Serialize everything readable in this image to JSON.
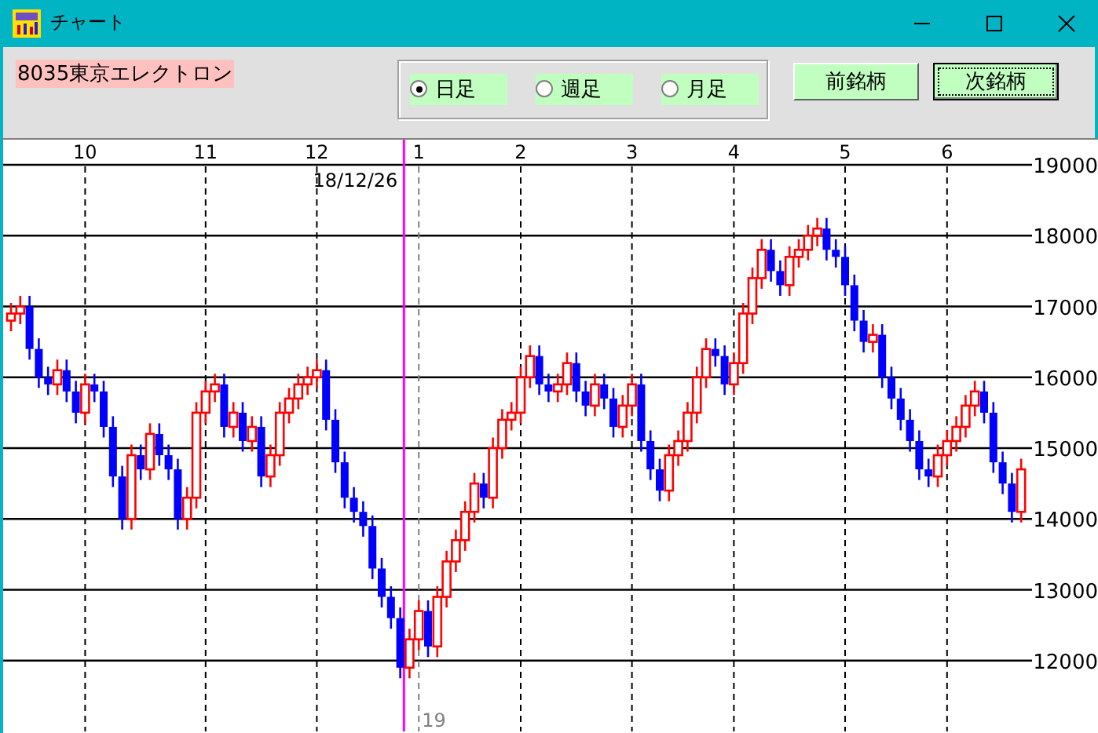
{
  "window": {
    "title": "チャート"
  },
  "stock_label": "8035東京エレクトロン",
  "period_options": [
    {
      "label": "日足",
      "selected": true
    },
    {
      "label": "週足",
      "selected": false
    },
    {
      "label": "月足",
      "selected": false
    }
  ],
  "buttons": [
    {
      "label": "前銘柄",
      "focused": false
    },
    {
      "label": "次銘柄",
      "focused": true
    }
  ],
  "chart": {
    "cursor_date": "18/12/26",
    "year_label": "19",
    "chart_data": {
      "type": "candlestick",
      "grid": true,
      "ylim": [
        11000,
        19000
      ],
      "yticks": [
        12000,
        13000,
        14000,
        15000,
        16000,
        17000,
        18000,
        19000
      ],
      "categories": [
        null,
        null,
        null,
        null,
        null,
        null,
        null,
        null,
        "10",
        null,
        null,
        null,
        null,
        null,
        null,
        null,
        null,
        null,
        null,
        null,
        null,
        "11",
        null,
        null,
        null,
        null,
        null,
        null,
        null,
        null,
        null,
        null,
        null,
        "12",
        null,
        null,
        null,
        null,
        null,
        null,
        null,
        null,
        null,
        null,
        "1",
        null,
        null,
        null,
        null,
        null,
        null,
        null,
        null,
        null,
        null,
        "2",
        null,
        null,
        null,
        null,
        null,
        null,
        null,
        null,
        null,
        null,
        null,
        "3",
        null,
        null,
        null,
        null,
        null,
        null,
        null,
        null,
        null,
        null,
        "4",
        null,
        null,
        null,
        null,
        null,
        null,
        null,
        null,
        null,
        null,
        null,
        "5",
        null,
        null,
        null,
        null,
        null,
        null,
        null,
        null,
        null,
        null,
        "6",
        null,
        null,
        null,
        null,
        null,
        null,
        null,
        null
      ],
      "ohlc": [
        [
          16800,
          17050,
          16650,
          16900
        ],
        [
          16900,
          17150,
          16750,
          17000
        ],
        [
          17000,
          17150,
          16250,
          16400
        ],
        [
          16400,
          16550,
          15850,
          16000
        ],
        [
          16000,
          16150,
          15750,
          15900
        ],
        [
          15900,
          16250,
          15750,
          16100
        ],
        [
          16100,
          16250,
          15650,
          15800
        ],
        [
          15800,
          15950,
          15350,
          15500
        ],
        [
          15500,
          16050,
          15350,
          15900
        ],
        [
          15900,
          16050,
          15650,
          15800
        ],
        [
          15800,
          15950,
          15150,
          15300
        ],
        [
          15300,
          15450,
          14450,
          14600
        ],
        [
          14600,
          14750,
          13850,
          14000
        ],
        [
          14000,
          15050,
          13850,
          14900
        ],
        [
          14900,
          15050,
          14550,
          14700
        ],
        [
          14700,
          15350,
          14550,
          15200
        ],
        [
          15200,
          15350,
          14750,
          14900
        ],
        [
          14900,
          15050,
          14550,
          14700
        ],
        [
          14700,
          14850,
          13850,
          14000
        ],
        [
          14000,
          14450,
          13850,
          14300
        ],
        [
          14300,
          15650,
          14150,
          15500
        ],
        [
          15500,
          15950,
          15350,
          15800
        ],
        [
          15800,
          16050,
          15650,
          15900
        ],
        [
          15900,
          16050,
          15150,
          15300
        ],
        [
          15300,
          15650,
          15150,
          15500
        ],
        [
          15500,
          15650,
          14950,
          15100
        ],
        [
          15100,
          15450,
          14950,
          15300
        ],
        [
          15300,
          15450,
          14450,
          14600
        ],
        [
          14600,
          15050,
          14450,
          14900
        ],
        [
          14900,
          15650,
          14750,
          15500
        ],
        [
          15500,
          15850,
          15350,
          15700
        ],
        [
          15700,
          16050,
          15550,
          15900
        ],
        [
          15900,
          16150,
          15750,
          16000
        ],
        [
          16000,
          16250,
          15850,
          16100
        ],
        [
          16100,
          16250,
          15250,
          15400
        ],
        [
          15400,
          15550,
          14650,
          14800
        ],
        [
          14800,
          14950,
          14150,
          14300
        ],
        [
          14300,
          14450,
          13950,
          14100
        ],
        [
          14100,
          14250,
          13750,
          13900
        ],
        [
          13900,
          14050,
          13150,
          13300
        ],
        [
          13300,
          13450,
          12750,
          12900
        ],
        [
          12900,
          13050,
          12450,
          12600
        ],
        [
          12600,
          12750,
          11750,
          11900
        ],
        [
          11900,
          12450,
          11750,
          12300
        ],
        [
          12300,
          12850,
          12150,
          12700
        ],
        [
          12700,
          12850,
          12050,
          12200
        ],
        [
          12200,
          13050,
          12050,
          12900
        ],
        [
          12900,
          13550,
          12750,
          13400
        ],
        [
          13400,
          13850,
          13250,
          13700
        ],
        [
          13700,
          14250,
          13550,
          14100
        ],
        [
          14100,
          14650,
          13950,
          14500
        ],
        [
          14500,
          14650,
          14150,
          14300
        ],
        [
          14300,
          15150,
          14150,
          15000
        ],
        [
          15000,
          15550,
          14850,
          15400
        ],
        [
          15400,
          15650,
          15250,
          15500
        ],
        [
          15500,
          16150,
          15350,
          16000
        ],
        [
          16000,
          16450,
          15850,
          16300
        ],
        [
          16300,
          16450,
          15750,
          15900
        ],
        [
          15900,
          16050,
          15650,
          15800
        ],
        [
          15800,
          16050,
          15650,
          15900
        ],
        [
          15900,
          16350,
          15750,
          16200
        ],
        [
          16200,
          16350,
          15650,
          15800
        ],
        [
          15800,
          15950,
          15450,
          15600
        ],
        [
          15600,
          16050,
          15450,
          15900
        ],
        [
          15900,
          16050,
          15550,
          15700
        ],
        [
          15700,
          15850,
          15150,
          15300
        ],
        [
          15300,
          15750,
          15150,
          15600
        ],
        [
          15600,
          16050,
          15450,
          15900
        ],
        [
          15900,
          16050,
          14950,
          15100
        ],
        [
          15100,
          15250,
          14550,
          14700
        ],
        [
          14700,
          14850,
          14250,
          14400
        ],
        [
          14400,
          15050,
          14250,
          14900
        ],
        [
          14900,
          15250,
          14750,
          15100
        ],
        [
          15100,
          15650,
          14950,
          15500
        ],
        [
          15500,
          16150,
          15350,
          16000
        ],
        [
          16000,
          16550,
          15850,
          16400
        ],
        [
          16400,
          16550,
          16150,
          16300
        ],
        [
          16300,
          16450,
          15750,
          15900
        ],
        [
          15900,
          16350,
          15750,
          16200
        ],
        [
          16200,
          17050,
          16050,
          16900
        ],
        [
          16900,
          17550,
          16750,
          17400
        ],
        [
          17400,
          17950,
          17250,
          17800
        ],
        [
          17800,
          17950,
          17350,
          17500
        ],
        [
          17500,
          17650,
          17150,
          17300
        ],
        [
          17300,
          17850,
          17150,
          17700
        ],
        [
          17700,
          17950,
          17550,
          17800
        ],
        [
          17800,
          18150,
          17650,
          18000
        ],
        [
          18000,
          18250,
          17850,
          18100
        ],
        [
          18100,
          18250,
          17650,
          17800
        ],
        [
          17800,
          17950,
          17550,
          17700
        ],
        [
          17700,
          17850,
          17150,
          17300
        ],
        [
          17300,
          17450,
          16650,
          16800
        ],
        [
          16800,
          16950,
          16350,
          16500
        ],
        [
          16500,
          16750,
          16350,
          16600
        ],
        [
          16600,
          16750,
          15850,
          16000
        ],
        [
          16000,
          16150,
          15550,
          15700
        ],
        [
          15700,
          15850,
          15250,
          15400
        ],
        [
          15400,
          15550,
          14950,
          15100
        ],
        [
          15100,
          15250,
          14550,
          14700
        ],
        [
          14700,
          14850,
          14450,
          14600
        ],
        [
          14600,
          15050,
          14450,
          14900
        ],
        [
          14900,
          15250,
          14750,
          15100
        ],
        [
          15100,
          15450,
          14950,
          15300
        ],
        [
          15300,
          15750,
          15150,
          15600
        ],
        [
          15600,
          15950,
          15450,
          15800
        ],
        [
          15800,
          15950,
          15350,
          15500
        ],
        [
          15500,
          15650,
          14650,
          14800
        ],
        [
          14800,
          14950,
          14350,
          14500
        ],
        [
          14500,
          14650,
          13950,
          14100
        ],
        [
          14100,
          14850,
          13950,
          14700
        ]
      ]
    }
  }
}
